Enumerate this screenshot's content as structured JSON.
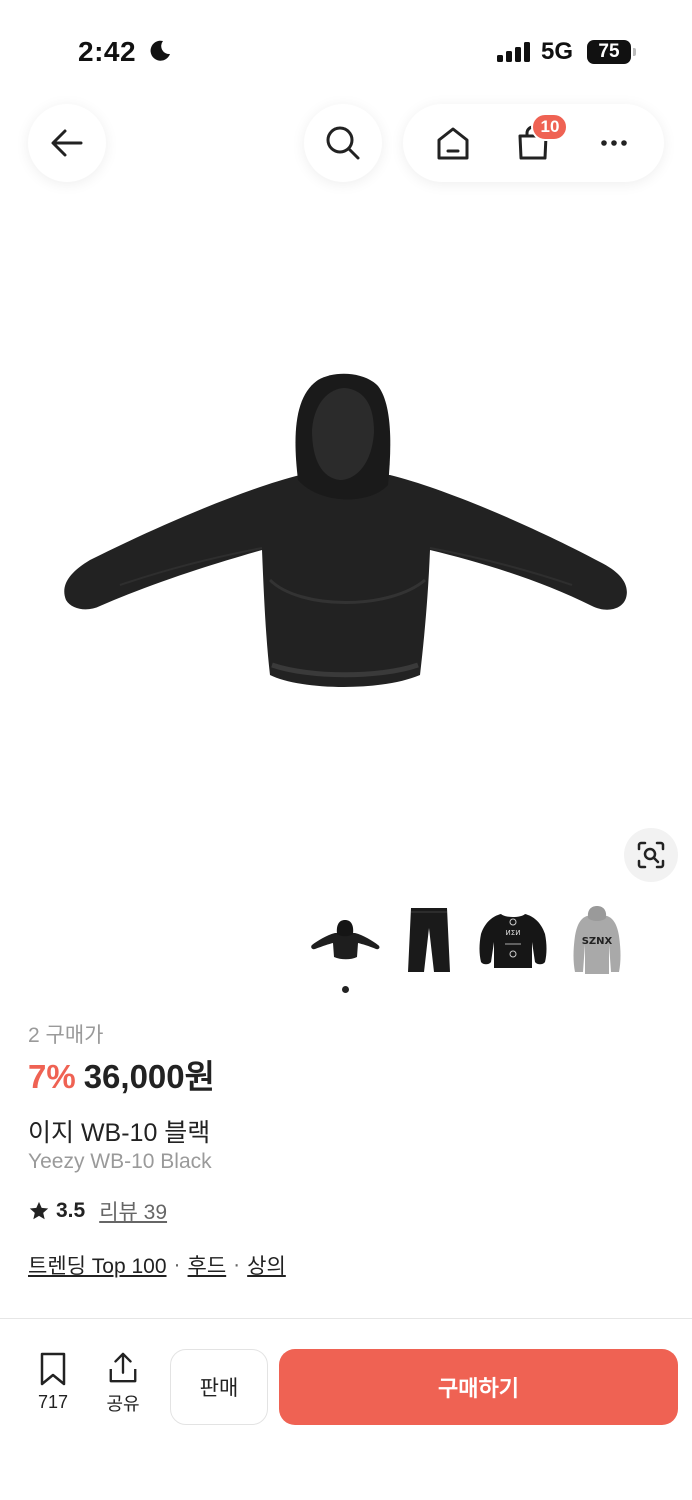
{
  "status_bar": {
    "time": "2:42",
    "network": "5G",
    "battery": "75"
  },
  "nav": {
    "back_icon": "arrow-left-icon",
    "search_icon": "search-icon",
    "home_icon": "home-icon",
    "cart_icon": "shopping-bag-icon",
    "cart_count": "10",
    "more_icon": "more-horizontal-icon"
  },
  "gallery": {
    "image_icon": "hoodie-black-product-image",
    "lens_icon": "visual-search-icon",
    "thumbnails": [
      "hoodie-black-thumb",
      "pants-black-thumb",
      "sweatshirt-black-thumb",
      "hoodie-grey-thumb"
    ],
    "thumb_text_sznx": "SZNX"
  },
  "product": {
    "buyers": "2 구매가",
    "discount": "7%",
    "price": "36,000원",
    "name_ko": "이지 WB-10 블랙",
    "name_en": "Yeezy WB-10 Black",
    "rating": "3.5",
    "review_label": "리뷰 39",
    "tags": [
      "트렌딩 Top 100",
      "후드",
      "상의"
    ],
    "tag_separator": "·"
  },
  "bottom_bar": {
    "bookmark_count": "717",
    "share_label": "공유",
    "sell_label": "판매",
    "buy_label": "구매하기"
  },
  "colors": {
    "accent": "#ef6253",
    "text": "#222222",
    "muted": "#9a9a9a"
  }
}
